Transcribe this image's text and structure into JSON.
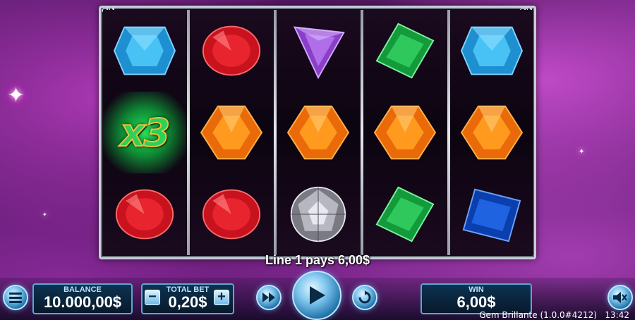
{
  "game": {
    "win_message": "Line 1 pays 6,00$",
    "footer_title": "Gem Brillante (1.0.0#4212)",
    "clock": "13:42"
  },
  "reels": {
    "multiplier_text": "x3",
    "grid": [
      [
        "blue-gem",
        "red-gem",
        "x3-multiplier"
      ],
      [
        "red-gem",
        "orange-gem",
        "red-gem"
      ],
      [
        "purple-gem",
        "orange-gem",
        "diamond"
      ],
      [
        "green-gem",
        "orange-gem",
        "green-gem"
      ],
      [
        "blue-gem",
        "orange-gem",
        "navy-gem"
      ]
    ]
  },
  "hud": {
    "balance_label": "BALANCE",
    "balance_value": "10.000,00$",
    "total_bet_label": "TOTAL BET",
    "total_bet_value": "0,20$",
    "win_label": "WIN",
    "win_value": "6,00$",
    "minus_label": "−",
    "plus_label": "+"
  },
  "icons": [
    "menu-icon",
    "fast-forward-icon",
    "play-icon",
    "autoplay-icon",
    "sound-muted-icon"
  ],
  "colors": {
    "accent_blue": "#5aa7d6",
    "x3_green": "#2ad15a",
    "background_purple": "#5a1a6e"
  }
}
